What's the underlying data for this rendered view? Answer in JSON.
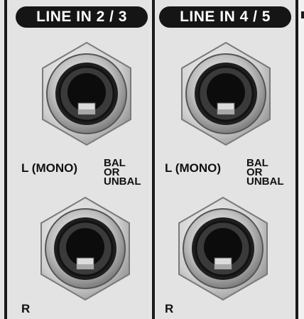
{
  "channels": [
    {
      "header": "LINE IN 2 / 3",
      "jacks": {
        "top_label": "L (MONO)",
        "bottom_label": "R"
      },
      "note": [
        "BAL",
        "OR",
        "UNBAL"
      ]
    },
    {
      "header": "LINE IN 4 / 5",
      "jacks": {
        "top_label": "L (MONO)",
        "bottom_label": "R"
      },
      "note": [
        "BAL",
        "OR",
        "UNBAL"
      ]
    }
  ],
  "colors": {
    "panel": "#e3e3e3",
    "header_bg": "#151515",
    "header_text": "#ffffff",
    "text": "#111111"
  },
  "icons": {
    "jack": "quarter-inch-jack-icon"
  }
}
